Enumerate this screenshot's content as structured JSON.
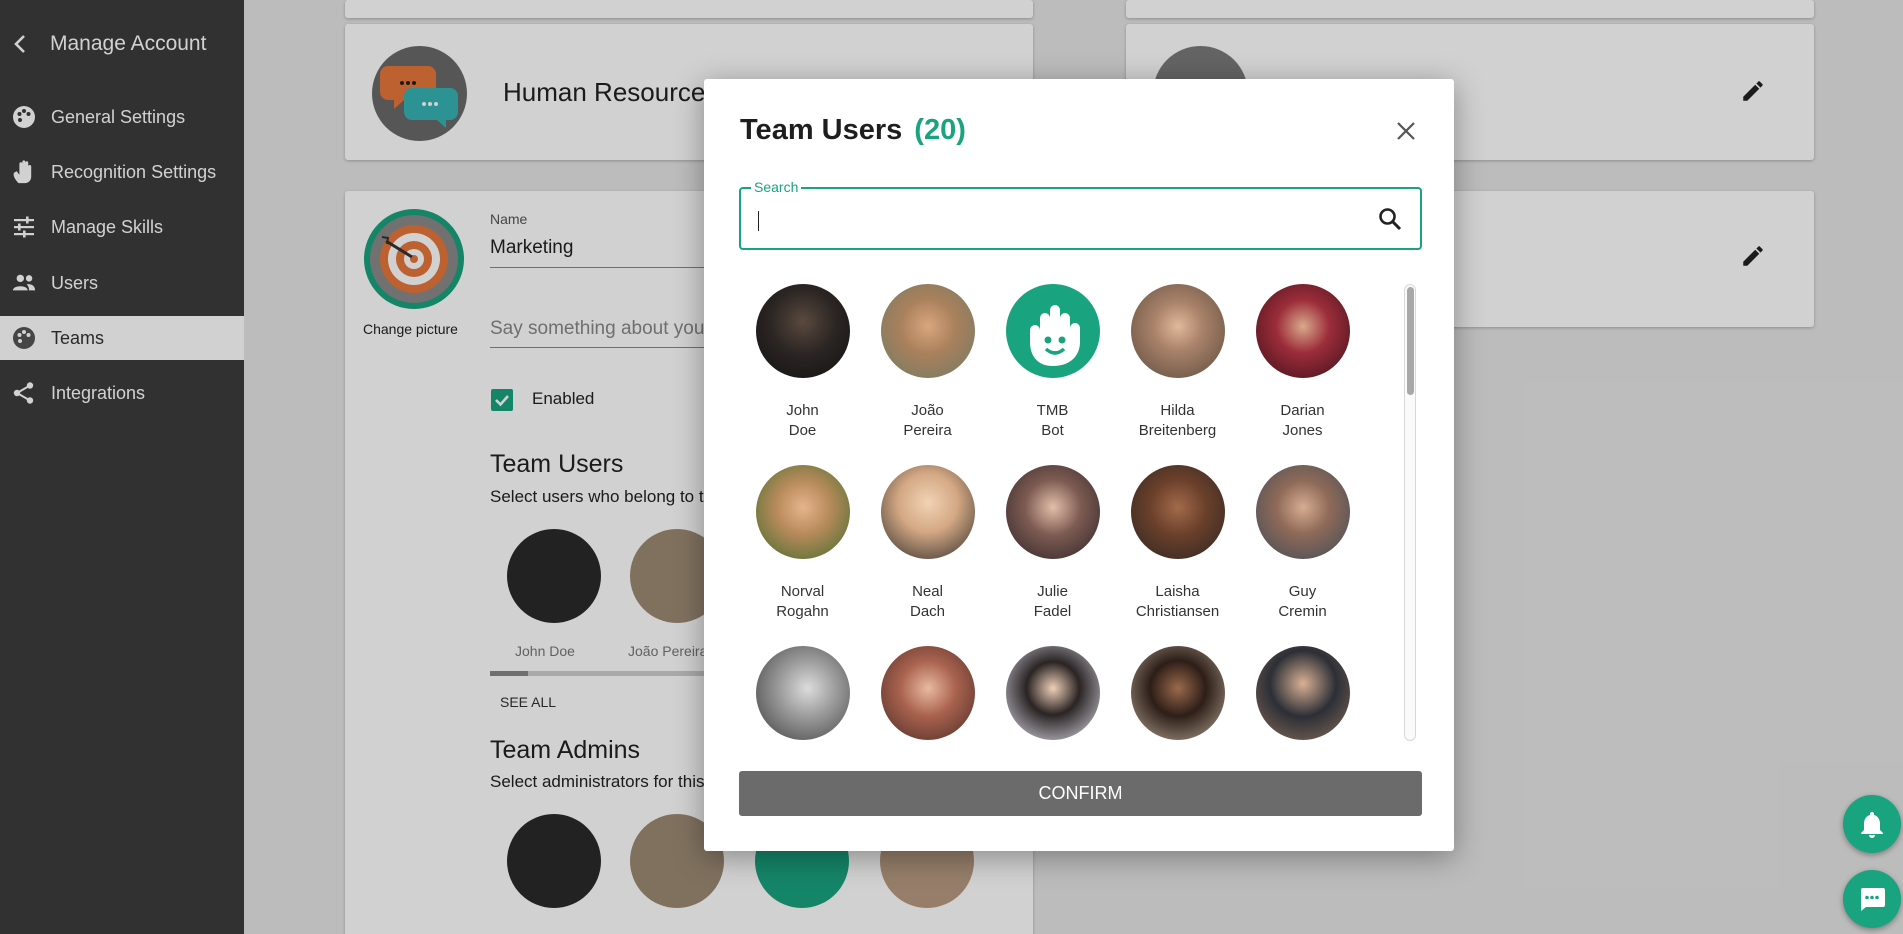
{
  "sidebar": {
    "title": "Manage Account",
    "items": [
      {
        "label": "General Settings",
        "icon": "palette-icon"
      },
      {
        "label": "Recognition Settings",
        "icon": "hand-icon"
      },
      {
        "label": "Manage Skills",
        "icon": "sliders-icon"
      },
      {
        "label": "Users",
        "icon": "people-icon"
      },
      {
        "label": "Teams",
        "icon": "teams-icon",
        "active": true
      },
      {
        "label": "Integrations",
        "icon": "share-icon"
      }
    ]
  },
  "background": {
    "team_card_1_name": "Human Resources",
    "form": {
      "change_picture": "Change picture",
      "name_label": "Name",
      "name_value": "Marketing",
      "description_placeholder": "Say something about your team",
      "enabled_label": "Enabled",
      "team_users_heading": "Team Users",
      "team_users_sub": "Select users who belong to this team",
      "team_users": [
        "John Doe",
        "João Pereira"
      ],
      "see_all": "SEE ALL",
      "team_admins_heading": "Team Admins",
      "team_admins_sub": "Select administrators for this team"
    }
  },
  "modal": {
    "title": "Team Users",
    "count": "(20)",
    "search_label": "Search",
    "search_value": "",
    "confirm_label": "CONFIRM",
    "users": [
      {
        "first": "John",
        "last": "Doe"
      },
      {
        "first": "João",
        "last": "Pereira"
      },
      {
        "first": "TMB",
        "last": "Bot"
      },
      {
        "first": "Hilda",
        "last": "Breitenberg"
      },
      {
        "first": "Darian",
        "last": "Jones"
      },
      {
        "first": "Norval",
        "last": "Rogahn"
      },
      {
        "first": "Neal",
        "last": "Dach"
      },
      {
        "first": "Julie",
        "last": "Fadel"
      },
      {
        "first": "Laisha",
        "last": "Christiansen"
      },
      {
        "first": "Guy",
        "last": "Cremin"
      },
      {
        "first": "",
        "last": ""
      },
      {
        "first": "",
        "last": ""
      },
      {
        "first": "",
        "last": ""
      },
      {
        "first": "",
        "last": ""
      },
      {
        "first": "",
        "last": ""
      }
    ]
  },
  "colors": {
    "accent": "#1aa37f",
    "sidebar_bg": "#3c3c3c",
    "confirm_bg": "#6b6b6b"
  }
}
